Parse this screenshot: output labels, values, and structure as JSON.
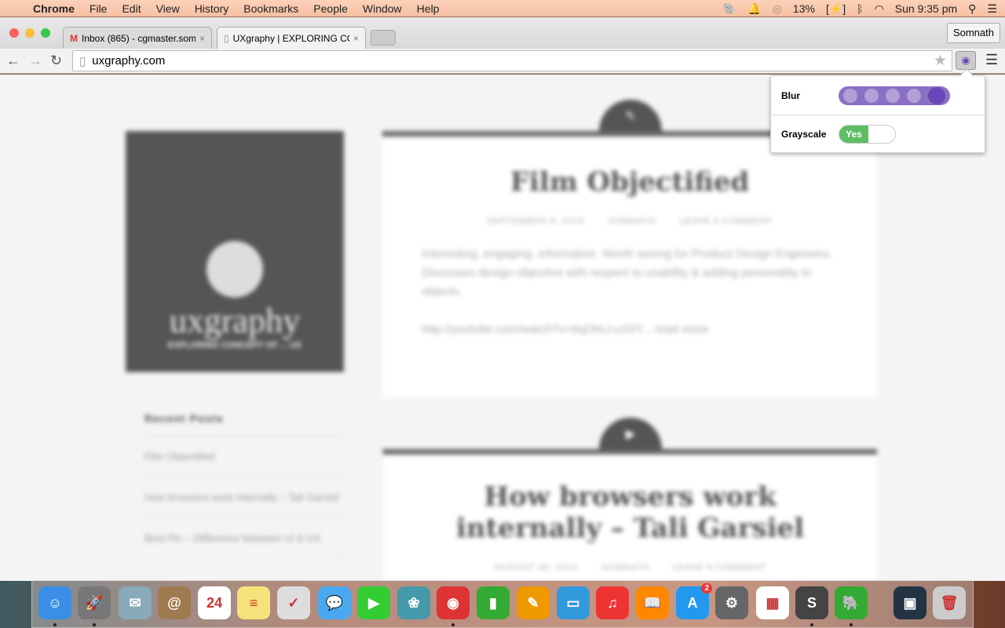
{
  "menubar": {
    "app": "Chrome",
    "items": [
      "File",
      "Edit",
      "View",
      "History",
      "Bookmarks",
      "People",
      "Window",
      "Help"
    ],
    "battery": "13%",
    "clock": "Sun 9:35 pm"
  },
  "tabs": [
    {
      "title": "Inbox (865) - cgmaster.som",
      "icon": "gmail-icon"
    },
    {
      "title": "UXgraphy | EXPLORING CC",
      "icon": "page-icon",
      "active": true
    }
  ],
  "profile": "Somnath",
  "address": "uxgraphy.com",
  "extension_popup": {
    "blur_label": "Blur",
    "blur_level": 5,
    "blur_max": 5,
    "grayscale_label": "Grayscale",
    "grayscale_value": "Yes",
    "accent": "#6a47b8",
    "toggle_color": "#5fbd63"
  },
  "page": {
    "logo": {
      "name": "uxgraphy",
      "tagline": "EXPLORING CONCEPT OF ... UX"
    },
    "posts": [
      {
        "title": "Film Objectified",
        "date": "September 8, 2014",
        "author": "Somnath",
        "comments": "Leave a comment",
        "body": "Interesting, engaging, informative. Worth seeing for Product Design Engineers. Discusses design objective with respect to usability & adding personality to objects.",
        "link": "http://youtube.com/watch?v=6qOhLt-uX0Y... read more"
      },
      {
        "title": "How browsers work internally – Tali Garsiel",
        "date": "August 26, 2014",
        "author": "Somnath",
        "comments": "Leave a comment"
      }
    ],
    "recent_posts": {
      "heading": "Recent Posts",
      "items": [
        "Film Objectified",
        "How browsers work internally – Tali Garsiel",
        "Best Pic – Difference between UI & UX"
      ]
    }
  },
  "dock": [
    {
      "name": "finder",
      "color": "#3a8ee6",
      "glyph": "☺",
      "running": true
    },
    {
      "name": "launchpad",
      "color": "#777",
      "glyph": "🚀",
      "running": true
    },
    {
      "name": "mail",
      "color": "#8ab",
      "glyph": "✉"
    },
    {
      "name": "contacts",
      "color": "#a07a50",
      "glyph": "@"
    },
    {
      "name": "calendar",
      "color": "#fff",
      "glyph": "24"
    },
    {
      "name": "notes",
      "color": "#f6e27a",
      "glyph": "≡"
    },
    {
      "name": "reminders",
      "color": "#ddd",
      "glyph": "✓"
    },
    {
      "name": "messages",
      "color": "#4aa8f0",
      "glyph": "💬"
    },
    {
      "name": "facetime",
      "color": "#3c3",
      "glyph": "▶"
    },
    {
      "name": "photos",
      "color": "#49a",
      "glyph": "❀"
    },
    {
      "name": "chrome",
      "color": "#d33",
      "glyph": "◉",
      "running": true
    },
    {
      "name": "numbers",
      "color": "#3a3",
      "glyph": "▮"
    },
    {
      "name": "pages",
      "color": "#e90",
      "glyph": "✎"
    },
    {
      "name": "keynote",
      "color": "#39d",
      "glyph": "▭"
    },
    {
      "name": "itunes",
      "color": "#e33",
      "glyph": "♫"
    },
    {
      "name": "ibooks",
      "color": "#f80",
      "glyph": "📖"
    },
    {
      "name": "app-store",
      "color": "#29e",
      "glyph": "A",
      "badge": "2"
    },
    {
      "name": "system-preferences",
      "color": "#666",
      "glyph": "⚙"
    },
    {
      "name": "slack",
      "color": "#fff",
      "glyph": "▦"
    },
    {
      "name": "sublime-text",
      "color": "#444",
      "glyph": "S",
      "running": true
    },
    {
      "name": "evernote",
      "color": "#3a3",
      "glyph": "🐘",
      "running": true
    },
    {
      "name": "movie-file",
      "color": "#234",
      "glyph": "▣"
    },
    {
      "name": "trash",
      "color": "#ccc",
      "glyph": "🗑"
    }
  ]
}
